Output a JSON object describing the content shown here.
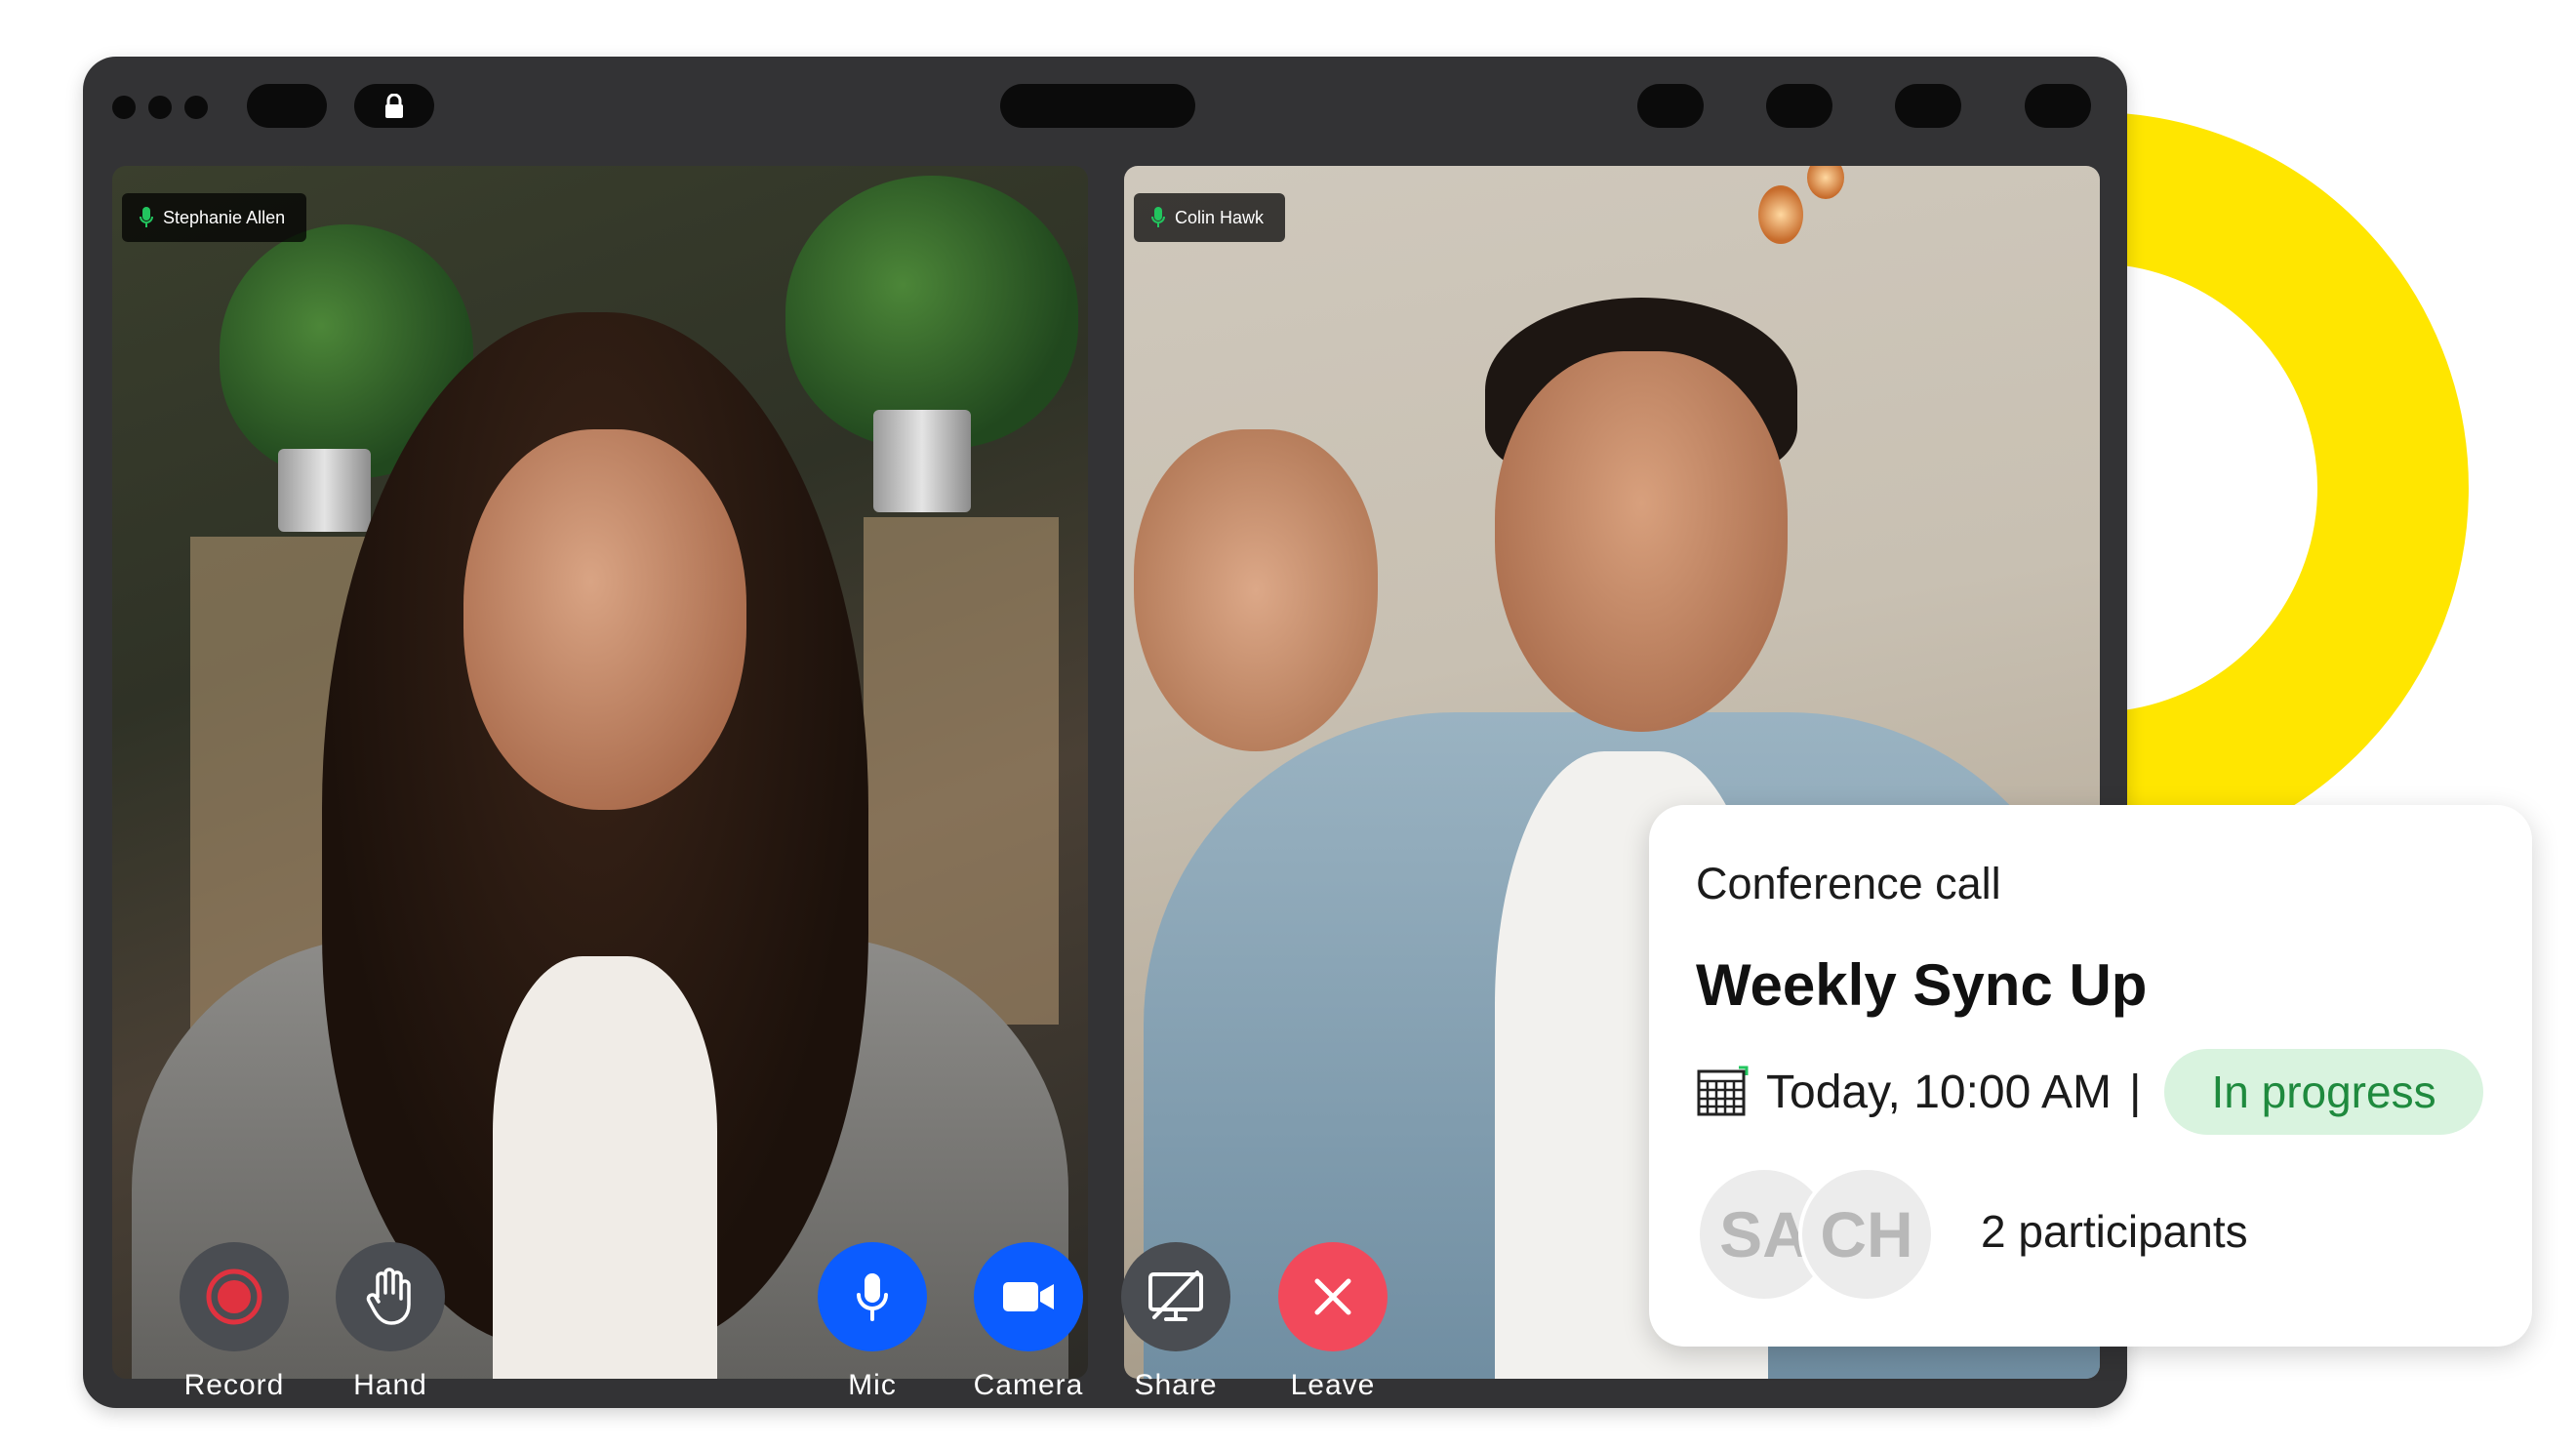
{
  "colors": {
    "accent_ring": "#ffe600",
    "window_bg": "#333335",
    "button_gray": "#4a4d52",
    "button_blue": "#0b5cff",
    "button_red": "#f2495b",
    "status_green_bg": "#d9f3df",
    "status_green_text": "#1f8a3e"
  },
  "window": {
    "titlebar": {
      "icons": [
        "dot",
        "dot",
        "dot",
        "pill",
        "lock-icon",
        "pill",
        "pill",
        "pill",
        "pill",
        "pill"
      ]
    }
  },
  "tiles": [
    {
      "name": "Stephanie Allen",
      "mic_icon": "mic-icon"
    },
    {
      "name": "Colin Hawk",
      "mic_icon": "mic-icon"
    }
  ],
  "controls": {
    "record": {
      "label": "Record",
      "icon": "record-icon"
    },
    "hand": {
      "label": "Hand",
      "icon": "hand-icon"
    },
    "mic": {
      "label": "Mic",
      "icon": "mic-icon"
    },
    "camera": {
      "label": "Camera",
      "icon": "camera-icon"
    },
    "share": {
      "label": "Share",
      "icon": "share-screen-off-icon"
    },
    "leave": {
      "label": "Leave",
      "icon": "close-icon"
    }
  },
  "card": {
    "subtitle": "Conference call",
    "title": "Weekly Sync Up",
    "calendar_icon": "calendar-icon",
    "time": "Today, 10:00 AM",
    "separator": "|",
    "status": "In progress",
    "avatars": [
      "SA",
      "CH"
    ],
    "participants": "2 participants"
  }
}
